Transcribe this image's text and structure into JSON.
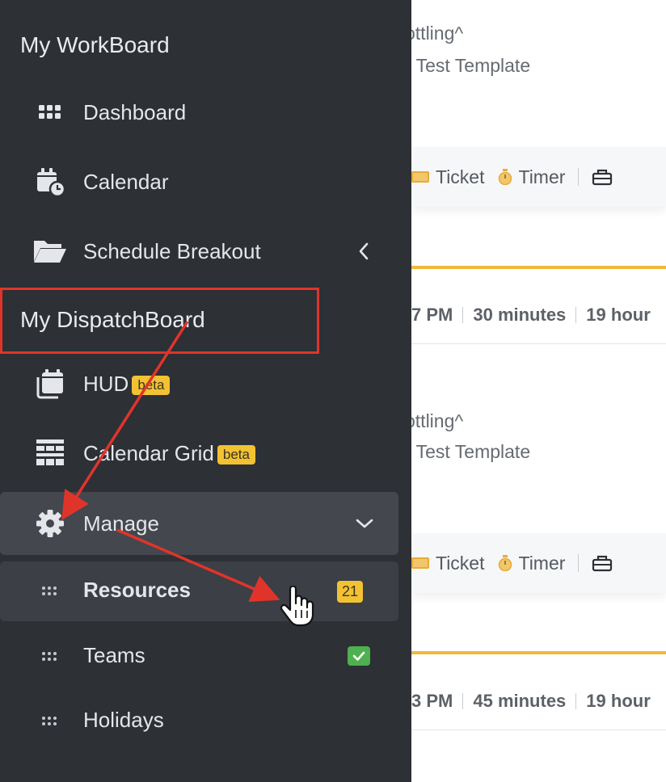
{
  "main": {
    "cards": [
      {
        "title_line1": "ottling^",
        "title_line2": "- Test Template",
        "toolbar": {
          "ticket_label": "Ticket",
          "timer_label": "Timer"
        },
        "meta": {
          "time": "7 PM",
          "duration": "30 minutes",
          "extra": "19 hour"
        }
      },
      {
        "title_line1": "ottling^",
        "title_line2": "- Test Template",
        "toolbar": {
          "ticket_label": "Ticket",
          "timer_label": "Timer"
        },
        "meta": {
          "time": "3 PM",
          "duration": "45 minutes",
          "extra": "19 hour"
        }
      }
    ]
  },
  "sidebar": {
    "workboard": {
      "title": "My WorkBoard",
      "items": [
        {
          "label": "Dashboard",
          "icon": "grid-icon"
        },
        {
          "label": "Calendar",
          "icon": "calendar-clock-icon"
        },
        {
          "label": "Schedule Breakout",
          "icon": "folder-open-icon"
        }
      ]
    },
    "dispatchboard": {
      "title": "My DispatchBoard",
      "items": [
        {
          "label": "HUD",
          "badge": "beta",
          "icon": "calendar-stack-icon"
        },
        {
          "label": "Calendar Grid",
          "badge": "beta",
          "icon": "table-grid-icon"
        },
        {
          "label": "Manage",
          "icon": "gear-icon"
        }
      ],
      "manage_subitems": [
        {
          "label": "Resources",
          "badge": "21"
        },
        {
          "label": "Teams",
          "badge_icon": "check-icon"
        },
        {
          "label": "Holidays"
        }
      ]
    }
  },
  "colors": {
    "sidebar_bg": "#2d3035",
    "accent_yellow": "#f2c233",
    "annotation_red": "#e0342b",
    "success_green": "#4fb04f"
  }
}
